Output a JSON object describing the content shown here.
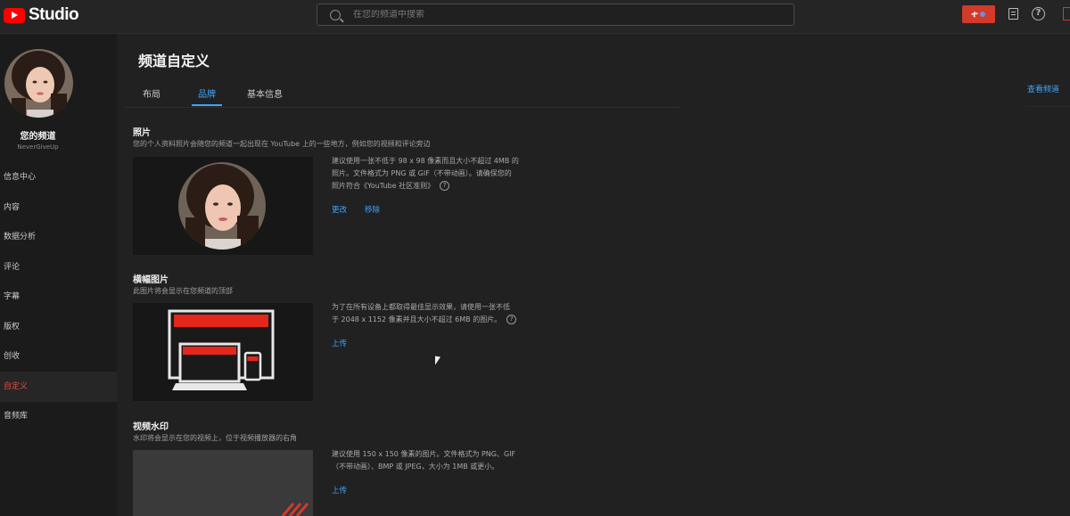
{
  "topbar": {
    "studio_label": "Studio",
    "search_placeholder": "在您的频道中搜索",
    "create_glyph": "ተ",
    "help_glyph": "?",
    "accent_color": "#d23a2a"
  },
  "sidebar": {
    "channel_name": "您的频道",
    "channel_handle": "NeverGiveUp",
    "items": [
      {
        "label": "信息中心",
        "active": false
      },
      {
        "label": "内容",
        "active": false
      },
      {
        "label": "数据分析",
        "active": false
      },
      {
        "label": "评论",
        "active": false
      },
      {
        "label": "字幕",
        "active": false
      },
      {
        "label": "版权",
        "active": false
      },
      {
        "label": "创收",
        "active": false
      },
      {
        "label": "自定义",
        "active": true
      },
      {
        "label": "音频库",
        "active": false
      }
    ]
  },
  "main": {
    "title": "频道自定义",
    "tabs": [
      {
        "label": "布局",
        "active": false
      },
      {
        "label": "品牌",
        "active": true
      },
      {
        "label": "基本信息",
        "active": false
      }
    ],
    "view_channel": "查看频道",
    "sections": {
      "photo": {
        "title": "照片",
        "subtitle": "您的个人资料照片会随您的频道一起出现在 YouTube 上的一些地方，例如您的视频和评论旁边",
        "desc_1": "建议使用一张不低于 98 x 98 像素而且大小不超过 4MB 的",
        "desc_2": "照片。文件格式为 PNG 或 GIF（不带动画）。请确保您的",
        "desc_3": "照片符合《YouTube 社区准则》",
        "change_label": "更改",
        "remove_label": "移除"
      },
      "banner": {
        "title": "横幅图片",
        "subtitle": "此图片将会显示在您频道的顶部",
        "desc_1": "为了在所有设备上都取得最佳显示效果，请使用一张不低",
        "desc_2": "于 2048 x 1152 像素并且大小不超过 6MB 的图片。",
        "upload_label": "上传"
      },
      "watermark": {
        "title": "视频水印",
        "subtitle": "水印将会显示在您的视频上，位于视频播放器的右角",
        "desc_1": "建议使用 150 x 150 像素的图片。文件格式为 PNG、GIF",
        "desc_2": "（不带动画）、BMP 或 JPEG，大小为 1MB 或更小。",
        "upload_label": "上传"
      }
    },
    "link_color": "#3ea6ff",
    "active_nav_color": "#ea4b3c"
  }
}
